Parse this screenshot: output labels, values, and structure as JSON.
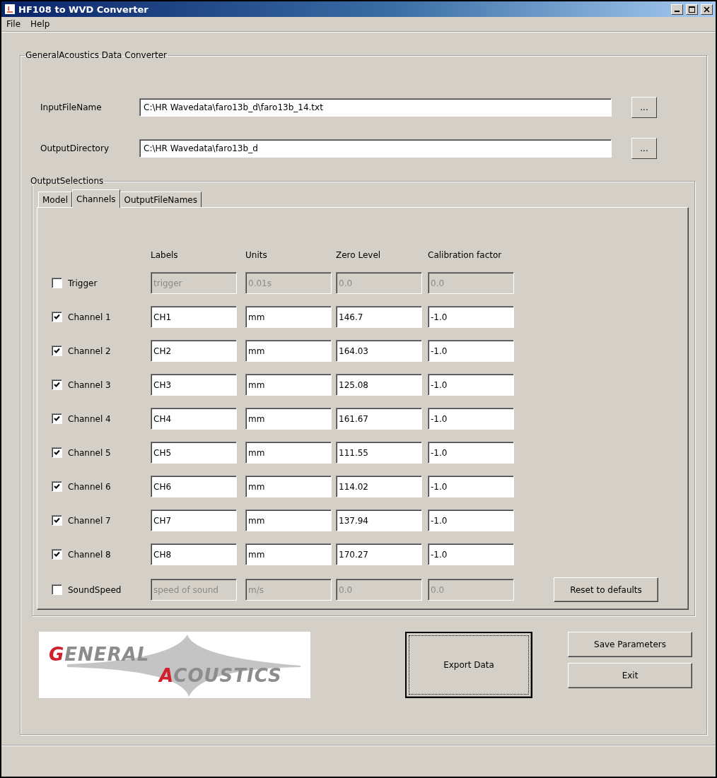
{
  "window": {
    "title": "HF108 to WVD Converter"
  },
  "menu": [
    "File",
    "Help"
  ],
  "converter": {
    "title": "GeneralAcoustics Data Converter",
    "paths": [
      {
        "label": "InputFileName",
        "value": "C:\\HR Wavedata\\faro13b_d\\faro13b_14.txt",
        "button": "..."
      },
      {
        "label": "OutputDirectory",
        "value": "C:\\HR Wavedata\\faro13b_d",
        "button": "..."
      }
    ],
    "output_selections": {
      "title": "OutputSelections",
      "tabs": [
        {
          "label": "Model",
          "selected": false
        },
        {
          "label": "Channels",
          "selected": true
        },
        {
          "label": "OutputFileNames",
          "selected": false
        }
      ],
      "columns": [
        "Labels",
        "Units",
        "Zero Level",
        "Calibration factor"
      ],
      "channels": [
        {
          "name": "Trigger",
          "checked": false,
          "label": "trigger",
          "units": "0.01s",
          "zero_level": "0.0",
          "calibration": "0.0"
        },
        {
          "name": "Channel 1",
          "checked": true,
          "label": "CH1",
          "units": "mm",
          "zero_level": "146.7",
          "calibration": "-1.0"
        },
        {
          "name": "Channel 2",
          "checked": true,
          "label": "CH2",
          "units": "mm",
          "zero_level": "164.03",
          "calibration": "-1.0"
        },
        {
          "name": "Channel 3",
          "checked": true,
          "label": "CH3",
          "units": "mm",
          "zero_level": "125.08",
          "calibration": "-1.0"
        },
        {
          "name": "Channel 4",
          "checked": true,
          "label": "CH4",
          "units": "mm",
          "zero_level": "161.67",
          "calibration": "-1.0"
        },
        {
          "name": "Channel 5",
          "checked": true,
          "label": "CH5",
          "units": "mm",
          "zero_level": "111.55",
          "calibration": "-1.0"
        },
        {
          "name": "Channel 6",
          "checked": true,
          "label": "CH6",
          "units": "mm",
          "zero_level": "114.02",
          "calibration": "-1.0"
        },
        {
          "name": "Channel 7",
          "checked": true,
          "label": "CH7",
          "units": "mm",
          "zero_level": "137.94",
          "calibration": "-1.0"
        },
        {
          "name": "Channel 8",
          "checked": true,
          "label": "CH8",
          "units": "mm",
          "zero_level": "170.27",
          "calibration": "-1.0"
        },
        {
          "name": "SoundSpeed",
          "checked": false,
          "label": "speed of sound",
          "units": "m/s",
          "zero_level": "0.0",
          "calibration": "0.0"
        }
      ],
      "reset_button": "Reset to defaults"
    },
    "logo": {
      "top": "GENERAL",
      "bottom": "ACOUSTICS"
    },
    "export_button": "Export Data",
    "save_button": "Save Parameters",
    "exit_button": "Exit"
  }
}
